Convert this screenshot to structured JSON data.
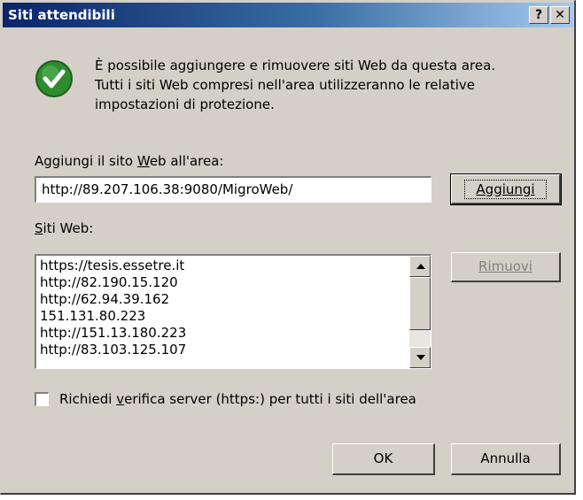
{
  "window": {
    "title": "Siti attendibili",
    "help_label": "?",
    "close_label": "✕"
  },
  "intro": {
    "icon": "check-icon",
    "line1": "È possibile aggiungere e rimuovere siti Web da questa area.",
    "line2": "Tutti i siti Web compresi nell'area utilizzeranno le relative",
    "line3": "impostazioni di protezione."
  },
  "add_section": {
    "label_pre": "Aggiungi il sito ",
    "label_key": "W",
    "label_post": "eb all'area:",
    "input_value": "http://89.207.106.38:9080/MigroWeb/",
    "add_button": "Aggiungi"
  },
  "sites_section": {
    "label_key": "S",
    "label_post": "iti Web:",
    "items": [
      "https://tesis.essetre.it",
      "http://82.190.15.120",
      "http://62.94.39.162",
      "151.131.80.223",
      "http://151.13.180.223",
      "http://83.103.125.107"
    ],
    "remove_button": "Rimuovi"
  },
  "checkbox": {
    "label_pre": "Richiedi ",
    "label_key": "v",
    "label_post": "erifica server (https:) per tutti i siti dell'area",
    "checked": false
  },
  "footer": {
    "ok": "OK",
    "cancel": "Annulla"
  },
  "colors": {
    "dialog_bg": "#d4d0c8",
    "titlebar_start": "#0a246a",
    "titlebar_end": "#a6caf0",
    "check_green": "#2e8b2e"
  }
}
